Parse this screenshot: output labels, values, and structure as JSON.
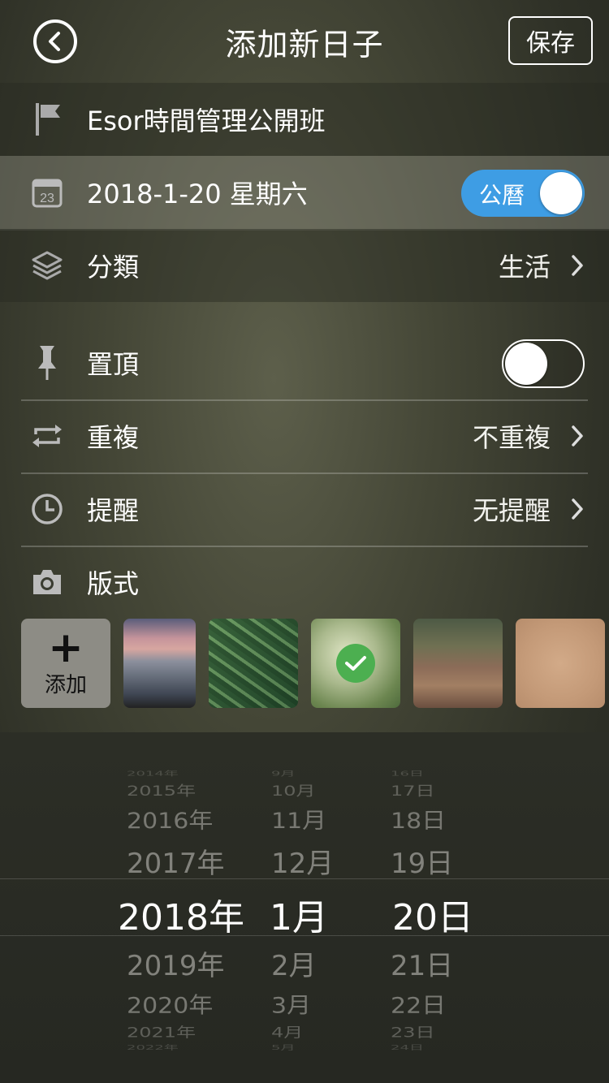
{
  "header": {
    "title": "添加新日子",
    "save_label": "保存"
  },
  "event": {
    "name": "Esor時間管理公開班",
    "date": "2018-1-20 星期六",
    "calendar_toggle_label": "公曆",
    "category_label": "分類",
    "category_value": "生活"
  },
  "options": {
    "pin_label": "置頂",
    "repeat_label": "重複",
    "repeat_value": "不重複",
    "reminder_label": "提醒",
    "reminder_value": "无提醒",
    "style_label": "版式",
    "add_label": "添加"
  },
  "picker": {
    "years": [
      "2014年",
      "2015年",
      "2016年",
      "2017年",
      "2018年",
      "2019年",
      "2020年",
      "2021年",
      "2022年"
    ],
    "months": [
      "9月",
      "10月",
      "11月",
      "12月",
      "1月",
      "2月",
      "3月",
      "4月",
      "5月"
    ],
    "days": [
      "16日",
      "17日",
      "18日",
      "19日",
      "20日",
      "21日",
      "22日",
      "23日",
      "24日"
    ],
    "selected_index": 4
  },
  "colors": {
    "accent": "#3e9de4",
    "check": "#4caf50"
  }
}
